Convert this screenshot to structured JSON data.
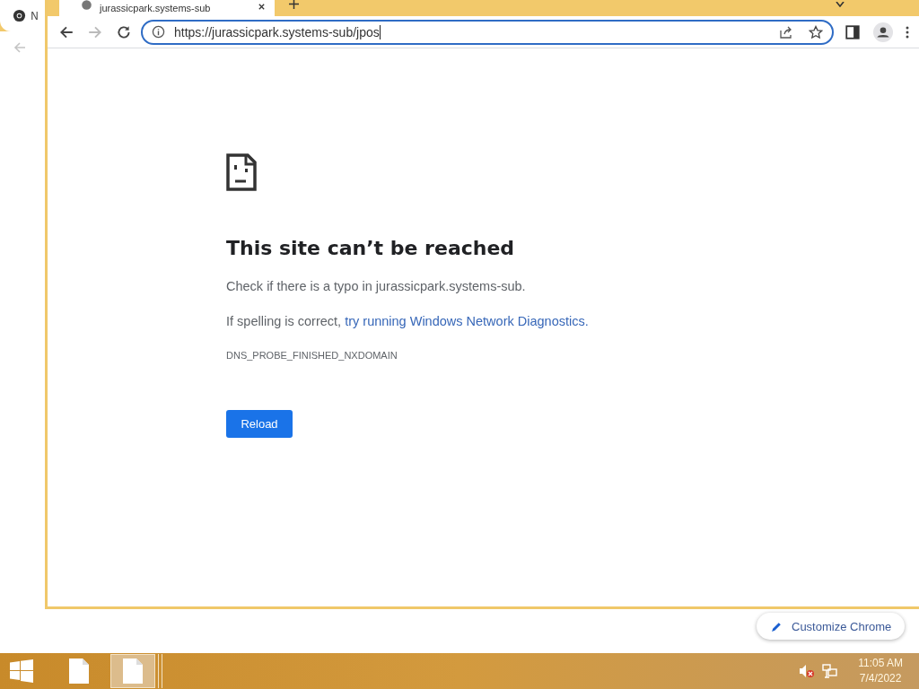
{
  "background_window": {
    "tab_title": "N"
  },
  "window": {
    "tab": {
      "title": "jurassicpark.systems-sub"
    },
    "address_bar": {
      "value": "https://jurassicpark.systems-sub/jpos"
    }
  },
  "error_page": {
    "title": "This site can’t be reached",
    "message": "Check if there is a typo in jurassicpark.systems-sub.",
    "suggestion_prefix": "If spelling is correct, ",
    "suggestion_link": "try running Windows Network Diagnostics.",
    "error_code": "DNS_PROBE_FINISHED_NXDOMAIN",
    "reload_button": "Reload"
  },
  "customize_button": "Customize Chrome",
  "taskbar": {
    "items": [
      {
        "selected": false
      },
      {
        "selected": true
      }
    ],
    "clock": {
      "time": "11:05 AM",
      "date": "7/4/2022"
    }
  }
}
